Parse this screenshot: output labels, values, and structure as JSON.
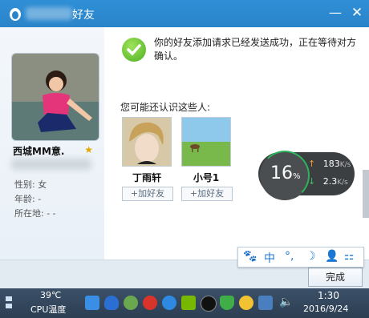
{
  "window": {
    "title": "好友",
    "minimize_label": "—",
    "close_label": "✕"
  },
  "profile": {
    "nickname": "西城MM意.",
    "gender_label": "性别:",
    "gender_value": "女",
    "age_label": "年龄:",
    "age_value": "-",
    "location_label": "所在地:",
    "location_value": "-   -"
  },
  "main": {
    "message": "你的好友添加请求已经发送成功，正在等待对方确认。",
    "might_know_label": "您可能还认识这些人:",
    "suggestions": [
      {
        "name": "丁雨轩",
        "add_label": "+加好友"
      },
      {
        "name": "小号1",
        "add_label": "+加好友"
      }
    ],
    "done_label": "完成"
  },
  "net_widget": {
    "cpu_percent": "16",
    "percent_sign": "%",
    "upload_speed": "183",
    "download_speed": "2.3",
    "unit": "K/s",
    "up_arrow": "↑",
    "down_arrow": "↓"
  },
  "ime": {
    "items": [
      "🐾",
      "中",
      "°,",
      "☽",
      "👤",
      "⚏"
    ]
  },
  "taskbar": {
    "temperature": "39℃",
    "cpu_label": "CPU温度",
    "time": "1:30",
    "date": "2016/9/24"
  },
  "colors": {
    "titlebar": "#2f8fd6",
    "check_green": "#4eb023",
    "cpu_ring": "#2fb35a"
  }
}
